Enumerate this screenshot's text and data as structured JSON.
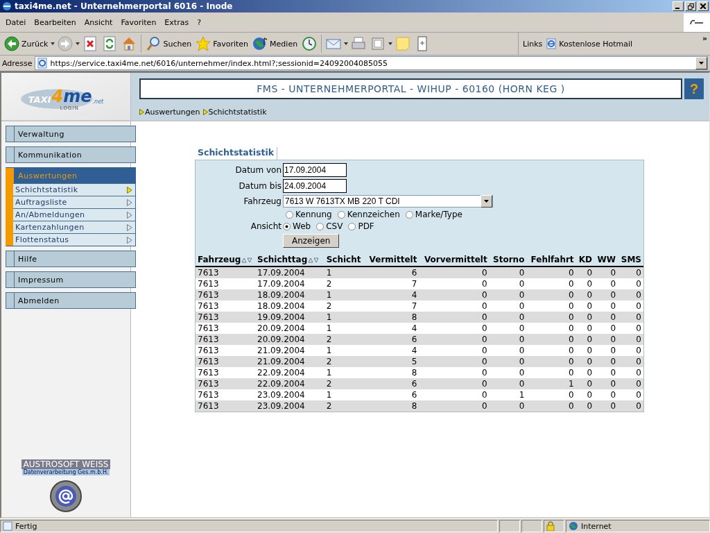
{
  "window": {
    "title": "taxi4me.net - Unternehmerportal 6016 - Inode"
  },
  "menu_bar": [
    "Datei",
    "Bearbeiten",
    "Ansicht",
    "Favoriten",
    "Extras",
    "?"
  ],
  "toolbar": [
    {
      "kind": "back",
      "label": "Zurück",
      "dropdown": true
    },
    {
      "kind": "forward",
      "dropdown": true
    },
    {
      "kind": "stop"
    },
    {
      "kind": "refresh"
    },
    {
      "kind": "home"
    },
    {
      "kind": "search",
      "label": "Suchen"
    },
    {
      "kind": "favorites",
      "label": "Favoriten"
    },
    {
      "kind": "media",
      "label": "Medien"
    },
    {
      "kind": "history"
    },
    {
      "kind": "mail",
      "dropdown": true
    },
    {
      "kind": "print"
    },
    {
      "kind": "edit",
      "dropdown": true
    },
    {
      "kind": "note"
    },
    {
      "kind": "messenger"
    }
  ],
  "links_bar": {
    "label": "Links",
    "items": [
      "Kostenlose Hotmail"
    ],
    "more": "»"
  },
  "address": {
    "label": "Adresse",
    "value": "https://service.taxi4me.net/6016/unternehmer/index.html?;sessionid=24092004085055"
  },
  "logo": {
    "brand": "TAXI",
    "highlight": "4me",
    "suffix": ".net",
    "tagline": "LOGIN"
  },
  "header": {
    "title": "FMS - UNTERNEHMERPORTAL - WIHUP - 60160 (HORN KEG )",
    "help": "?"
  },
  "breadcrumb": [
    "Auswertungen",
    "Schichtstatistik"
  ],
  "sidebar": {
    "items": [
      {
        "label": "Verwaltung",
        "selected": false
      },
      {
        "label": "Kommunikation",
        "selected": false
      },
      {
        "label": "Auswertungen",
        "selected": true,
        "children": [
          {
            "label": "Schichtstatistik",
            "selected": true
          },
          {
            "label": "Auftragsliste",
            "selected": false
          },
          {
            "label": "An/Abmeldungen",
            "selected": false
          },
          {
            "label": "Kartenzahlungen",
            "selected": false
          },
          {
            "label": "Flottenstatus",
            "selected": false
          }
        ]
      },
      {
        "label": "Hilfe",
        "selected": false
      },
      {
        "label": "Impressum",
        "selected": false
      },
      {
        "label": "Abmelden",
        "selected": false
      }
    ]
  },
  "sponsor": {
    "name": "AUSTROSOFT WEISS",
    "subtitle": "Datenverarbeitung Ges.m.b.H."
  },
  "form": {
    "title": "Schichtstatistik",
    "date_from": {
      "label": "Datum von",
      "value": "17.09.2004"
    },
    "date_to": {
      "label": "Datum bis",
      "value": "24.09.2004"
    },
    "vehicle": {
      "label": "Fahrzeug",
      "value": "7613 W 7613TX MB 220 T CDI"
    },
    "display_options": [
      {
        "label": "Kennung",
        "selected": false
      },
      {
        "label": "Kennzeichen",
        "selected": false
      },
      {
        "label": "Marke/Type",
        "selected": false
      }
    ],
    "view": {
      "label": "Ansicht",
      "options": [
        {
          "label": "Web",
          "selected": true
        },
        {
          "label": "CSV",
          "selected": false
        },
        {
          "label": "PDF",
          "selected": false
        }
      ]
    },
    "button": "Anzeigen"
  },
  "table": {
    "columns": [
      {
        "label": "Fahrzeug",
        "sortable": true
      },
      {
        "label": "Schichttag",
        "sortable": true
      },
      {
        "label": "Schicht",
        "sortable": false
      },
      {
        "label": "Vermittelt",
        "sortable": false
      },
      {
        "label": "Vorvermittelt",
        "sortable": false
      },
      {
        "label": "Storno",
        "sortable": false
      },
      {
        "label": "Fehlfahrt",
        "sortable": false
      },
      {
        "label": "KD",
        "sortable": false
      },
      {
        "label": "WW",
        "sortable": false
      },
      {
        "label": "SMS",
        "sortable": false
      }
    ],
    "rows": [
      [
        "7613",
        "17.09.2004",
        "1",
        "6",
        "0",
        "0",
        "0",
        "0",
        "0",
        "0"
      ],
      [
        "7613",
        "17.09.2004",
        "2",
        "7",
        "0",
        "0",
        "0",
        "0",
        "0",
        "0"
      ],
      [
        "7613",
        "18.09.2004",
        "1",
        "4",
        "0",
        "0",
        "0",
        "0",
        "0",
        "0"
      ],
      [
        "7613",
        "18.09.2004",
        "2",
        "7",
        "0",
        "0",
        "0",
        "0",
        "0",
        "0"
      ],
      [
        "7613",
        "19.09.2004",
        "1",
        "8",
        "0",
        "0",
        "0",
        "0",
        "0",
        "0"
      ],
      [
        "7613",
        "20.09.2004",
        "1",
        "4",
        "0",
        "0",
        "0",
        "0",
        "0",
        "0"
      ],
      [
        "7613",
        "20.09.2004",
        "2",
        "6",
        "0",
        "0",
        "0",
        "0",
        "0",
        "0"
      ],
      [
        "7613",
        "21.09.2004",
        "1",
        "4",
        "0",
        "0",
        "0",
        "0",
        "0",
        "0"
      ],
      [
        "7613",
        "21.09.2004",
        "2",
        "5",
        "0",
        "0",
        "0",
        "0",
        "0",
        "0"
      ],
      [
        "7613",
        "22.09.2004",
        "1",
        "8",
        "0",
        "0",
        "0",
        "0",
        "0",
        "0"
      ],
      [
        "7613",
        "22.09.2004",
        "2",
        "6",
        "0",
        "0",
        "1",
        "0",
        "0",
        "0"
      ],
      [
        "7613",
        "23.09.2004",
        "1",
        "6",
        "0",
        "1",
        "0",
        "0",
        "0",
        "0"
      ],
      [
        "7613",
        "23.09.2004",
        "2",
        "8",
        "0",
        "0",
        "0",
        "0",
        "0",
        "0"
      ]
    ]
  },
  "status_bar": {
    "text": "Fertig",
    "secure": true,
    "zone": "Internet"
  }
}
